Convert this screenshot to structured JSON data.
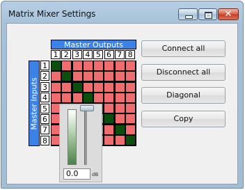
{
  "window": {
    "title": "Matrix Mixer Settings"
  },
  "controls": {
    "minimize_icon": "minimize-icon",
    "maximize_icon": "maximize-icon",
    "close_icon": "close-icon",
    "close_glyph": "✕"
  },
  "matrix": {
    "outputs_label": "Master Outputs",
    "inputs_label": "Master Inputs",
    "columns": [
      "1",
      "2",
      "3",
      "4",
      "5",
      "6",
      "7",
      "8"
    ],
    "rows": [
      "1",
      "2",
      "3",
      "4",
      "5",
      "6",
      "7",
      "8"
    ],
    "connections": [
      [
        1,
        0,
        0,
        0,
        0,
        0,
        0,
        0
      ],
      [
        0,
        1,
        0,
        0,
        0,
        0,
        0,
        0
      ],
      [
        0,
        0,
        1,
        0,
        0,
        0,
        0,
        0
      ],
      [
        0,
        0,
        0,
        1,
        0,
        0,
        0,
        0
      ],
      [
        0,
        0,
        0,
        0,
        1,
        0,
        0,
        0
      ],
      [
        0,
        0,
        0,
        0,
        0,
        1,
        0,
        0
      ],
      [
        0,
        0,
        0,
        0,
        0,
        0,
        1,
        0
      ],
      [
        0,
        0,
        0,
        0,
        0,
        0,
        0,
        1
      ]
    ]
  },
  "buttons": {
    "connect_all": "Connect all",
    "disconnect_all": "Disconnect all",
    "diagonal": "Diagonal",
    "copy": "Copy"
  },
  "fader": {
    "value": "0.0",
    "unit": "dB",
    "level": 1.0
  },
  "colors": {
    "connected": "#0c4f0c",
    "disconnected": "#ef6d6d",
    "header": "#3c82e6"
  }
}
